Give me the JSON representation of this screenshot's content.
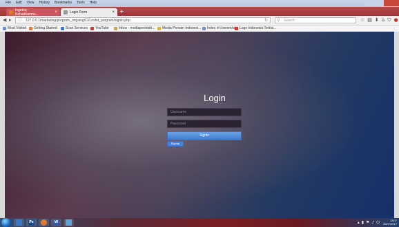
{
  "menubar": {
    "items": [
      "File",
      "Edit",
      "View",
      "History",
      "Bookmarks",
      "Tools",
      "Help"
    ]
  },
  "tabs": [
    {
      "label": "Ingeteq - Kehadiranmu...",
      "icon": "site-favicon"
    },
    {
      "label": "Login Form",
      "icon": "page-icon"
    }
  ],
  "navbar": {
    "url": "127.0.0.1/marketing/program_ongoing/CI/Loshd_program/signin.php",
    "search_placeholder": "Search"
  },
  "bookmarks": [
    {
      "label": "Most Visited",
      "color": "#6a8fd3"
    },
    {
      "label": "Getting Started",
      "color": "#e07b2c"
    },
    {
      "label": "Scan Services",
      "color": "#3c78c8"
    },
    {
      "label": "YouTube",
      "color": "#d9302a"
    },
    {
      "label": "Inbox - mediaperintah...",
      "color": "#d9a42a"
    },
    {
      "label": "Media Pemain Indonesi...",
      "color": "#e0b42c"
    },
    {
      "label": "Index of /cmmm/a/",
      "color": "#6a8fd3"
    },
    {
      "label": "Logo Indonesia Terkai...",
      "color": "#d9302a"
    }
  ],
  "login": {
    "title": "Login",
    "username_placeholder": "Username",
    "password_placeholder": "Password",
    "signin_label": "Signin",
    "signup_label": "Signup"
  },
  "taskbar": {
    "apps": [
      {
        "name": "explorer-icon",
        "color": "#3c78c8",
        "glyph": ""
      },
      {
        "name": "photoshop-icon",
        "color": "#1b4d8c",
        "glyph": "Ps"
      },
      {
        "name": "firefox-icon",
        "color": "#e07b2c",
        "glyph": ""
      },
      {
        "name": "word-icon",
        "color": "#2a5db0",
        "glyph": "W"
      },
      {
        "name": "app-icon",
        "color": "#5aa5d8",
        "glyph": ""
      }
    ],
    "time": "13:07",
    "date": "26/07/2017"
  }
}
